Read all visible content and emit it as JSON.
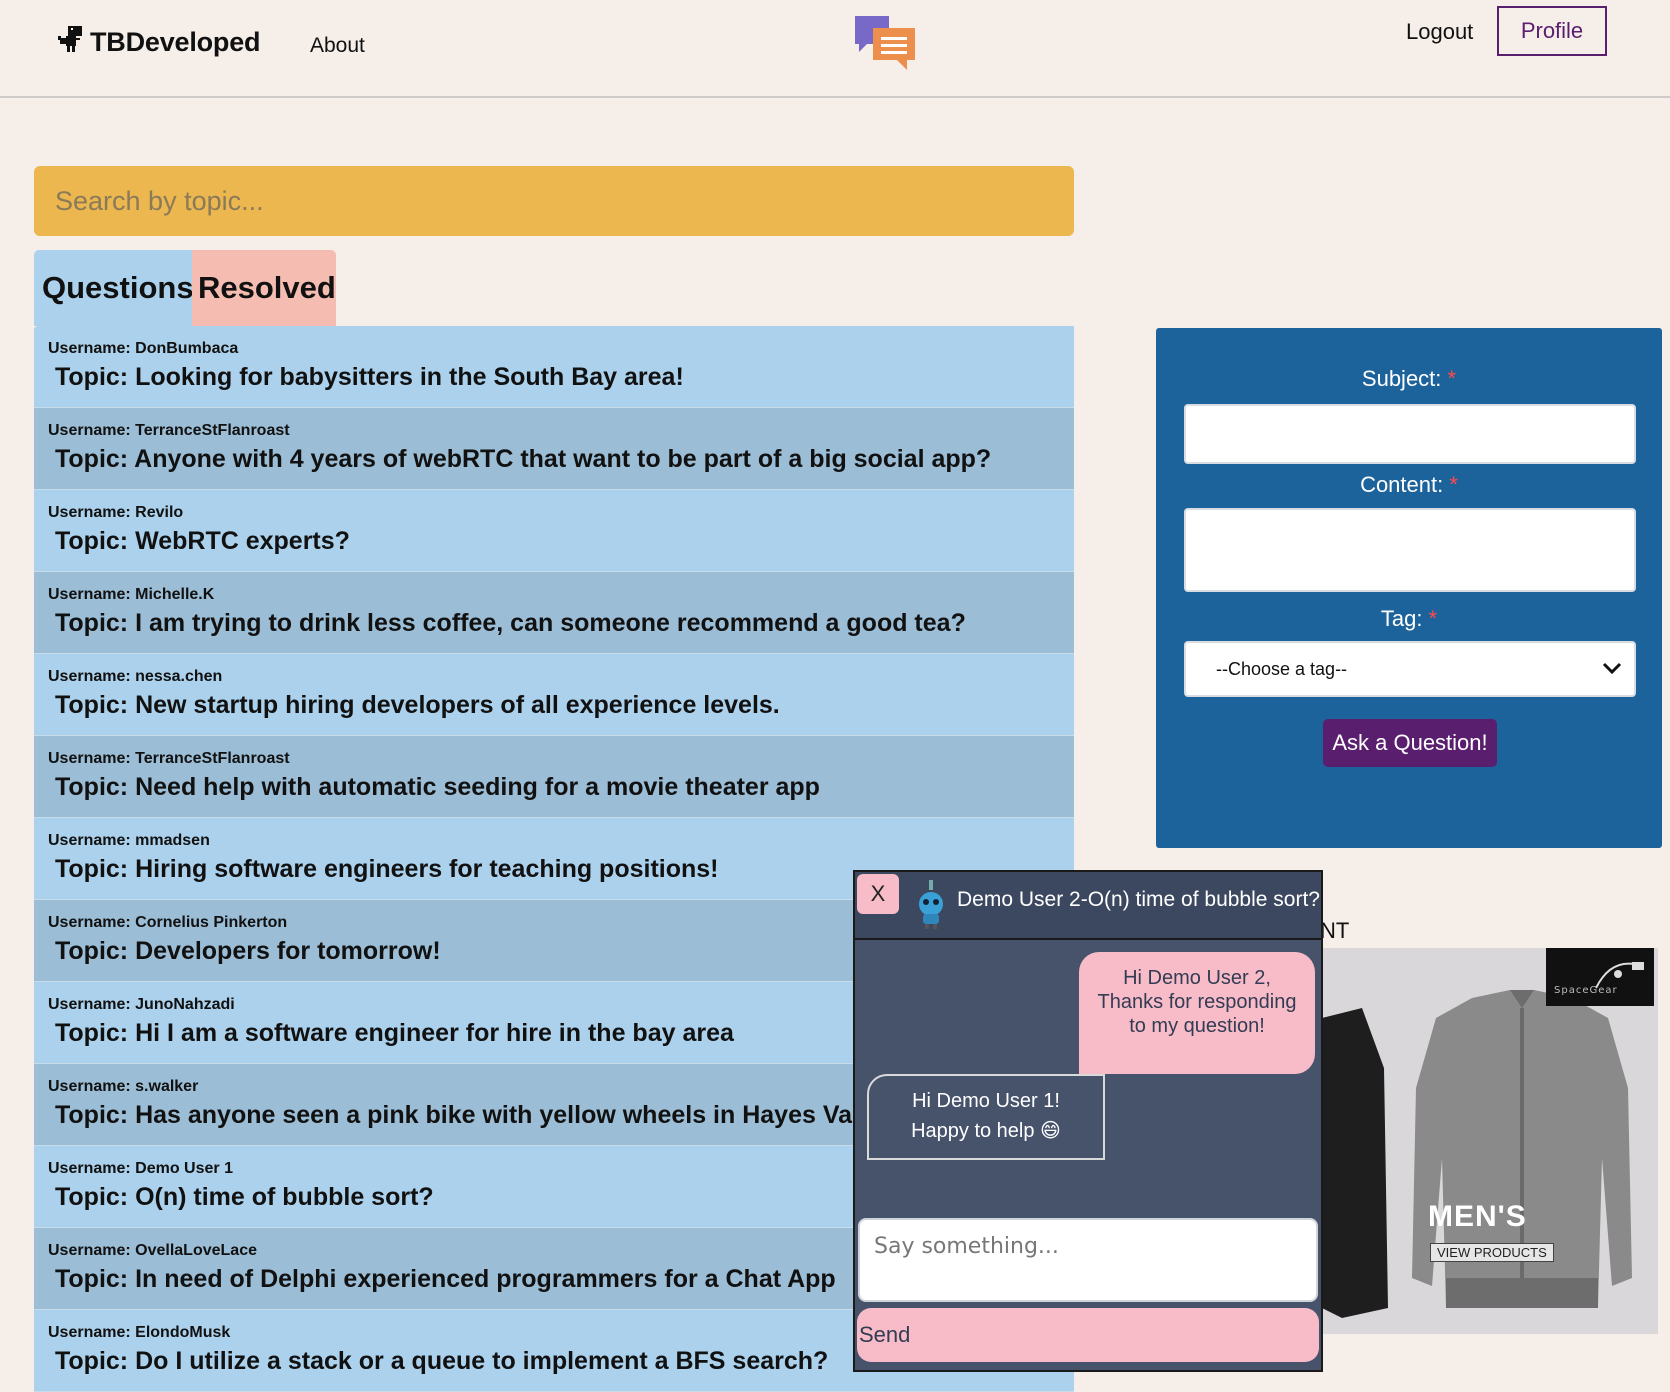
{
  "header": {
    "brand": "TBDeveloped",
    "about": "About",
    "logout": "Logout",
    "profile": "Profile"
  },
  "search": {
    "placeholder": "Search by topic..."
  },
  "tabs": [
    {
      "label": "Questions"
    },
    {
      "label": "Resolved"
    }
  ],
  "questions": [
    {
      "username_label": "Username: DonBumbaca",
      "topic": "Topic: Looking for babysitters in the South Bay area!"
    },
    {
      "username_label": "Username: TerranceStFlanroast",
      "topic": "Topic: Anyone with 4 years of webRTC that want to be part of a big social app?"
    },
    {
      "username_label": "Username: Revilo",
      "topic": "Topic: WebRTC experts?"
    },
    {
      "username_label": "Username: Michelle.K",
      "topic": "Topic: I am trying to drink less coffee, can someone recommend a good tea?"
    },
    {
      "username_label": "Username: nessa.chen",
      "topic": "Topic: New startup hiring developers of all experience levels."
    },
    {
      "username_label": "Username: TerranceStFlanroast",
      "topic": "Topic: Need help with automatic seeding for a movie theater app"
    },
    {
      "username_label": "Username: mmadsen",
      "topic": "Topic: Hiring software engineers for teaching positions!"
    },
    {
      "username_label": "Username: Cornelius Pinkerton",
      "topic": "Topic: Developers for tomorrow!"
    },
    {
      "username_label": "Username: JunoNahzadi",
      "topic": "Topic: Hi I am a software engineer for hire in the bay area"
    },
    {
      "username_label": "Username: s.walker",
      "topic": "Topic: Has anyone seen a pink bike with yellow wheels in Hayes Va"
    },
    {
      "username_label": "Username: Demo User 1",
      "topic": "Topic: O(n) time of bubble sort?"
    },
    {
      "username_label": "Username: OvellaLoveLace",
      "topic": "Topic: In need of Delphi experienced programmers for a Chat App"
    },
    {
      "username_label": "Username: ElondoMusk",
      "topic": "Topic: Do I utilize a stack or a queue to implement a BFS search?"
    }
  ],
  "ask_form": {
    "subject_label": "Subject:",
    "content_label": "Content:",
    "tag_label": "Tag:",
    "required_mark": "*",
    "tag_selected": "--Choose a tag--",
    "submit": "Ask a Question!"
  },
  "ad": {
    "title_fragment": "NT",
    "brand": "SpaceGear",
    "headline": "MEN'S",
    "cta": "VIEW PRODUCTS"
  },
  "chat": {
    "close": "X",
    "title": "Demo User 2-O(n) time of bubble sort?",
    "messages": [
      {
        "from": "me",
        "text": "Hi Demo User 2, Thanks for responding to my question!"
      },
      {
        "from": "them",
        "line1": "Hi Demo User 1!",
        "line2": "Happy to help 😄"
      }
    ],
    "input_placeholder": "Say something...",
    "send": "Send"
  },
  "colors": {
    "page_bg": "#f6eee9",
    "search_bg": "#ecb74e",
    "tab_questions": "#abd1ec",
    "tab_resolved": "#f5bdb1",
    "form_bg": "#1d639b",
    "brand_purple": "#5a1e6e",
    "chat_bg": "#46536b",
    "chat_pink": "#f7bcc7"
  },
  "icons": [
    "dino-icon",
    "chat-bubbles-icon",
    "chevron-down-icon",
    "robot-avatar-icon"
  ]
}
